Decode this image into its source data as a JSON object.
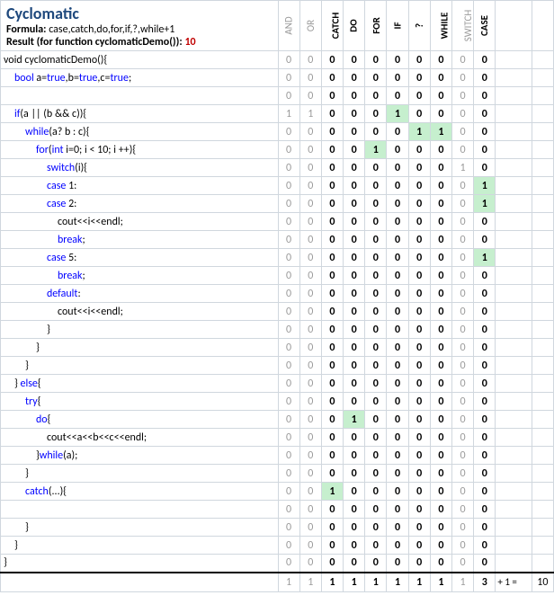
{
  "header": {
    "title": "Cyclomatic",
    "formula_label": "Formula:",
    "formula_value": "case,catch,do,for,if,?,while+1",
    "result_label": "Result (for function cyclomaticDemo()):",
    "result_value": "10"
  },
  "columns": [
    {
      "label": "AND",
      "bold": false
    },
    {
      "label": "OR",
      "bold": false
    },
    {
      "label": "CATCH",
      "bold": true
    },
    {
      "label": "DO",
      "bold": true
    },
    {
      "label": "FOR",
      "bold": true
    },
    {
      "label": "IF",
      "bold": true
    },
    {
      "label": "?",
      "bold": true
    },
    {
      "label": "WHILE",
      "bold": true
    },
    {
      "label": "SWITCH",
      "bold": false
    },
    {
      "label": "CASE",
      "bold": true
    }
  ],
  "rows": [
    {
      "code": "void cyclomaticDemo(){",
      "indent": 0,
      "v": [
        0,
        0,
        0,
        0,
        0,
        0,
        0,
        0,
        0,
        0
      ],
      "hl": []
    },
    {
      "code": "bool a=true,b=true,c=true;",
      "indent": 1,
      "v": [
        0,
        0,
        0,
        0,
        0,
        0,
        0,
        0,
        0,
        0
      ],
      "hl": [],
      "kw": [
        "bool",
        "true"
      ]
    },
    {
      "code": "",
      "indent": 0,
      "v": [
        0,
        0,
        0,
        0,
        0,
        0,
        0,
        0,
        0,
        0
      ],
      "hl": []
    },
    {
      "code": "if(a || (b && c)){",
      "indent": 1,
      "v": [
        1,
        1,
        0,
        0,
        0,
        1,
        0,
        0,
        0,
        0
      ],
      "hl": [
        5
      ],
      "kw": [
        "if"
      ]
    },
    {
      "code": "while(a? b : c){",
      "indent": 2,
      "v": [
        0,
        0,
        0,
        0,
        0,
        0,
        1,
        1,
        0,
        0
      ],
      "hl": [
        6,
        7
      ],
      "kw": [
        "while"
      ]
    },
    {
      "code": "for(int i=0; i < 10; i ++){",
      "indent": 3,
      "v": [
        0,
        0,
        0,
        0,
        1,
        0,
        0,
        0,
        0,
        0
      ],
      "hl": [
        4
      ],
      "kw": [
        "for",
        "int"
      ]
    },
    {
      "code": "switch(i){",
      "indent": 4,
      "v": [
        0,
        0,
        0,
        0,
        0,
        0,
        0,
        0,
        1,
        0
      ],
      "hl": [],
      "kw": [
        "switch"
      ]
    },
    {
      "code": "case 1:",
      "indent": 4,
      "v": [
        0,
        0,
        0,
        0,
        0,
        0,
        0,
        0,
        0,
        1
      ],
      "hl": [
        9
      ],
      "kw": [
        "case"
      ]
    },
    {
      "code": "case 2:",
      "indent": 4,
      "v": [
        0,
        0,
        0,
        0,
        0,
        0,
        0,
        0,
        0,
        1
      ],
      "hl": [
        9
      ],
      "kw": [
        "case"
      ]
    },
    {
      "code": "cout<<i<<endl;",
      "indent": 5,
      "v": [
        0,
        0,
        0,
        0,
        0,
        0,
        0,
        0,
        0,
        0
      ],
      "hl": []
    },
    {
      "code": "break;",
      "indent": 5,
      "v": [
        0,
        0,
        0,
        0,
        0,
        0,
        0,
        0,
        0,
        0
      ],
      "hl": [],
      "kw": [
        "break"
      ]
    },
    {
      "code": "case 5:",
      "indent": 4,
      "v": [
        0,
        0,
        0,
        0,
        0,
        0,
        0,
        0,
        0,
        1
      ],
      "hl": [
        9
      ],
      "kw": [
        "case"
      ]
    },
    {
      "code": "break;",
      "indent": 5,
      "v": [
        0,
        0,
        0,
        0,
        0,
        0,
        0,
        0,
        0,
        0
      ],
      "hl": [],
      "kw": [
        "break"
      ]
    },
    {
      "code": "default:",
      "indent": 4,
      "v": [
        0,
        0,
        0,
        0,
        0,
        0,
        0,
        0,
        0,
        0
      ],
      "hl": [],
      "kw": [
        "default"
      ]
    },
    {
      "code": "cout<<i<<endl;",
      "indent": 5,
      "v": [
        0,
        0,
        0,
        0,
        0,
        0,
        0,
        0,
        0,
        0
      ],
      "hl": []
    },
    {
      "code": "}",
      "indent": 4,
      "v": [
        0,
        0,
        0,
        0,
        0,
        0,
        0,
        0,
        0,
        0
      ],
      "hl": []
    },
    {
      "code": "}",
      "indent": 3,
      "v": [
        0,
        0,
        0,
        0,
        0,
        0,
        0,
        0,
        0,
        0
      ],
      "hl": []
    },
    {
      "code": "}",
      "indent": 2,
      "v": [
        0,
        0,
        0,
        0,
        0,
        0,
        0,
        0,
        0,
        0
      ],
      "hl": []
    },
    {
      "code": "} else{",
      "indent": 1,
      "v": [
        0,
        0,
        0,
        0,
        0,
        0,
        0,
        0,
        0,
        0
      ],
      "hl": [],
      "kw": [
        "else"
      ]
    },
    {
      "code": "try{",
      "indent": 2,
      "v": [
        0,
        0,
        0,
        0,
        0,
        0,
        0,
        0,
        0,
        0
      ],
      "hl": [],
      "kw": [
        "try"
      ]
    },
    {
      "code": "do{",
      "indent": 3,
      "v": [
        0,
        0,
        0,
        1,
        0,
        0,
        0,
        0,
        0,
        0
      ],
      "hl": [
        3
      ],
      "kw": [
        "do"
      ]
    },
    {
      "code": "cout<<a<<b<<c<<endl;",
      "indent": 4,
      "v": [
        0,
        0,
        0,
        0,
        0,
        0,
        0,
        0,
        0,
        0
      ],
      "hl": []
    },
    {
      "code": "}while(a);",
      "indent": 3,
      "v": [
        0,
        0,
        0,
        0,
        0,
        0,
        0,
        0,
        0,
        0
      ],
      "hl": [],
      "kw": [
        "while"
      ]
    },
    {
      "code": "}",
      "indent": 2,
      "v": [
        0,
        0,
        0,
        0,
        0,
        0,
        0,
        0,
        0,
        0
      ],
      "hl": []
    },
    {
      "code": "catch(...){",
      "indent": 2,
      "v": [
        0,
        0,
        1,
        0,
        0,
        0,
        0,
        0,
        0,
        0
      ],
      "hl": [
        2
      ],
      "kw": [
        "catch"
      ]
    },
    {
      "code": "",
      "indent": 0,
      "v": [
        0,
        0,
        0,
        0,
        0,
        0,
        0,
        0,
        0,
        0
      ],
      "hl": []
    },
    {
      "code": "}",
      "indent": 2,
      "v": [
        0,
        0,
        0,
        0,
        0,
        0,
        0,
        0,
        0,
        0
      ],
      "hl": []
    },
    {
      "code": "}",
      "indent": 1,
      "v": [
        0,
        0,
        0,
        0,
        0,
        0,
        0,
        0,
        0,
        0
      ],
      "hl": []
    },
    {
      "code": "}",
      "indent": 0,
      "v": [
        0,
        0,
        0,
        0,
        0,
        0,
        0,
        0,
        0,
        0
      ],
      "hl": []
    }
  ],
  "sums": [
    1,
    1,
    1,
    1,
    1,
    1,
    1,
    1,
    1,
    3
  ],
  "sum_suffix": "+ 1 =",
  "sum_total": "10",
  "chart_data": {
    "type": "table",
    "title": "Cyclomatic complexity token counts per source line",
    "columns": [
      "AND",
      "OR",
      "CATCH",
      "DO",
      "FOR",
      "IF",
      "?",
      "WHILE",
      "SWITCH",
      "CASE"
    ],
    "column_totals": [
      1,
      1,
      1,
      1,
      1,
      1,
      1,
      1,
      1,
      3
    ],
    "formula": "case,catch,do,for,if,?,while+1",
    "result": 10
  }
}
